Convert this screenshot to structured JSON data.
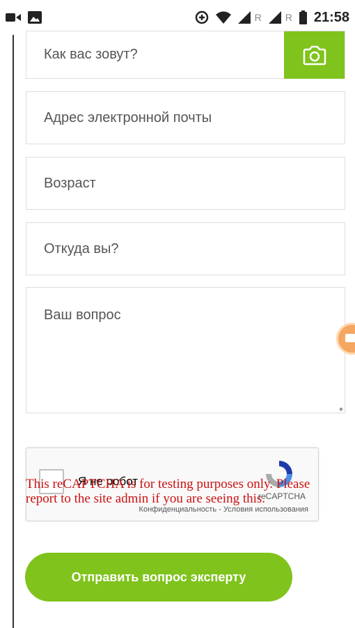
{
  "status_bar": {
    "time": "21:58",
    "roaming_1": "R",
    "roaming_2": "R",
    "icons": [
      "video-icon",
      "image-icon",
      "data-saver-icon",
      "wifi-icon",
      "signal-icon",
      "signal-icon",
      "battery-icon"
    ]
  },
  "form": {
    "name_placeholder": "Как вас зовут?",
    "email_placeholder": "Адрес электронной почты",
    "age_placeholder": "Возраст",
    "location_placeholder": "Откуда вы?",
    "question_placeholder": "Ваш вопрос",
    "camera_icon": "camera-icon",
    "accent_color": "#7fc31c"
  },
  "recaptcha": {
    "label": "Я не робот",
    "brand": "reCAPTCHA",
    "links": "Конфиденциальность - Условия использования",
    "warning": "This reCAPTCHA is for testing purposes only. Please report to the site admin if you are seeing this."
  },
  "submit_label": "Отправить вопрос эксперту"
}
